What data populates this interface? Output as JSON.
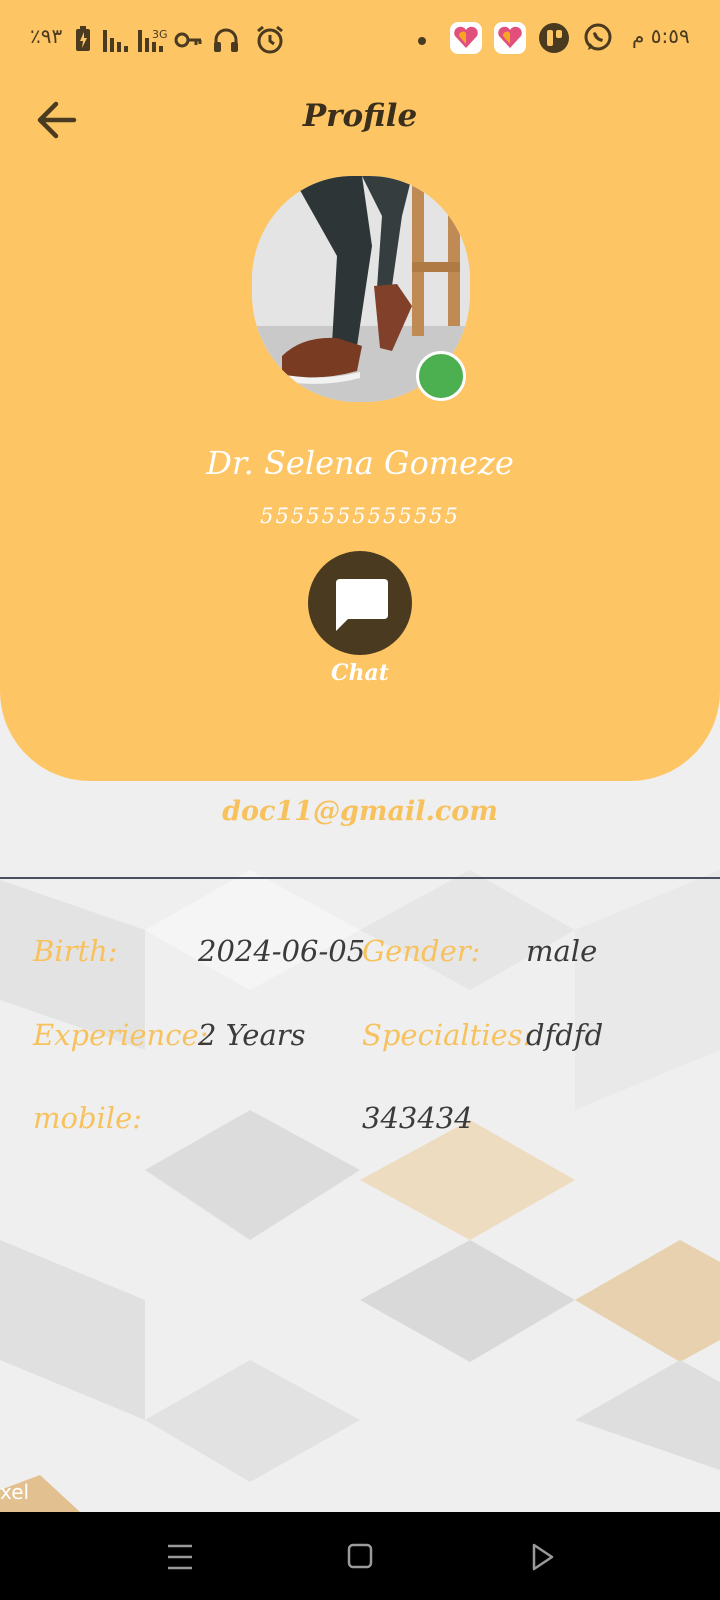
{
  "status_bar": {
    "battery": "٪٩٣",
    "network": "3G",
    "time": "٥:٥٩ م",
    "icons": [
      "battery-charging-icon",
      "signal-icon",
      "signal-icon",
      "key-icon",
      "headphones-icon",
      "alarm-icon",
      "dot-icon",
      "heart-app-icon",
      "heart-app-icon",
      "app-icon",
      "whatsapp-icon"
    ]
  },
  "header": {
    "title": "Profile",
    "back_icon": "arrow-left-icon"
  },
  "profile": {
    "name": "Dr. Selena Gomeze",
    "phone": "5555555555555",
    "online": true,
    "chat_label": "Chat",
    "chat_icon": "chat-bubble-icon",
    "email": "doc11@gmail.com"
  },
  "details": {
    "birth_label": "Birth:",
    "birth_value": "2024-06-05",
    "gender_label": "Gender:",
    "gender_value": "male",
    "experience_label": "Experience:",
    "experience_value": "2 Years",
    "specialties_label": "Specialties:",
    "specialties_value": "dfdfd",
    "mobile_label": "mobile:",
    "mobile_value": "343434"
  },
  "watermark": "xel",
  "colors": {
    "accent": "#fdc564",
    "label": "#f7c25e",
    "dark": "#4a3b20",
    "online": "#4caf50"
  }
}
